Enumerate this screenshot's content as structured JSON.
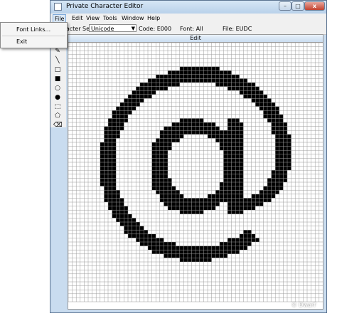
{
  "window": {
    "title": "Private Character Editor",
    "controls": {
      "minimize": "–",
      "maximize": "□",
      "close": "x"
    }
  },
  "menubar": {
    "file": "File",
    "edit": "Edit",
    "view": "View",
    "tools": "Tools",
    "window": "Window",
    "help": "Help"
  },
  "toolbar": {
    "charset_label": "Character Set:",
    "charset_value": "Unicode",
    "code": "Code: E000",
    "font": "Font: All",
    "file": "File: EUDC"
  },
  "tools": [
    {
      "name": "pencil-icon",
      "glyph": "✎"
    },
    {
      "name": "line-icon",
      "glyph": "╲"
    },
    {
      "name": "hollow-rect-icon",
      "glyph": "□"
    },
    {
      "name": "filled-rect-icon",
      "glyph": "■"
    },
    {
      "name": "hollow-ellipse-icon",
      "glyph": "○"
    },
    {
      "name": "filled-ellipse-icon",
      "glyph": "●"
    },
    {
      "name": "rect-select-icon",
      "glyph": "⬚"
    },
    {
      "name": "freeform-select-icon",
      "glyph": "⬠"
    },
    {
      "name": "eraser-icon",
      "glyph": "⌫"
    }
  ],
  "edit_pane": {
    "title": "Edit"
  },
  "file_menu": {
    "font_links": "Font Links...",
    "exit": "Exit"
  },
  "glyph": {
    "char": "@",
    "fill_color": "#000000",
    "grid_color": "#9a9a9a"
  },
  "watermark": "© Dwarf"
}
